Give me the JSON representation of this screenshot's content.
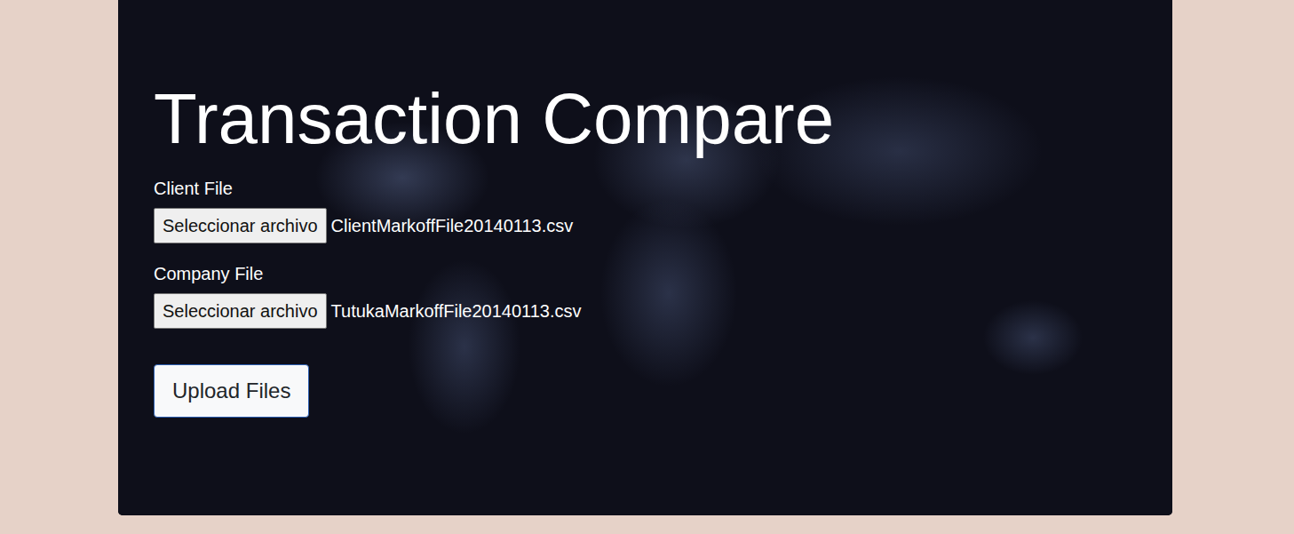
{
  "title": "Transaction Compare",
  "fields": [
    {
      "label": "Client File",
      "button": "Seleccionar archivo",
      "file": "ClientMarkoffFile20140113.csv"
    },
    {
      "label": "Company File",
      "button": "Seleccionar archivo",
      "file": "TutukaMarkoffFile20140113.csv"
    }
  ],
  "submit": "Upload Files"
}
